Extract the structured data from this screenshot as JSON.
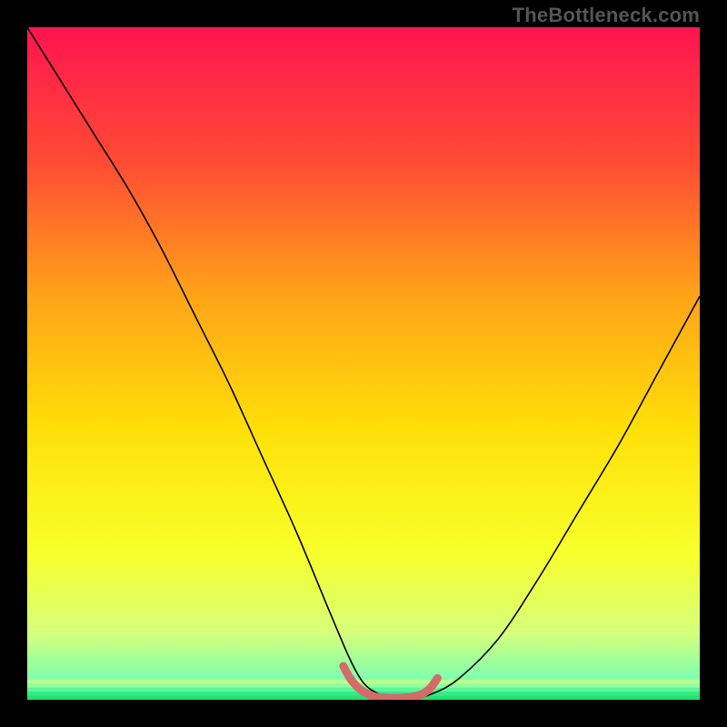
{
  "watermark": "TheBottleneck.com",
  "chart_data": {
    "type": "line",
    "title": "",
    "xlabel": "",
    "ylabel": "",
    "xlim": [
      0,
      100
    ],
    "ylim": [
      0,
      100
    ],
    "gradient_stops": [
      {
        "offset": 0.0,
        "color": "#ff1450"
      },
      {
        "offset": 0.2,
        "color": "#ff4b34"
      },
      {
        "offset": 0.4,
        "color": "#ffa418"
      },
      {
        "offset": 0.6,
        "color": "#ffe008"
      },
      {
        "offset": 0.78,
        "color": "#f8ff2a"
      },
      {
        "offset": 0.9,
        "color": "#d6ff7a"
      },
      {
        "offset": 0.97,
        "color": "#7dffb0"
      },
      {
        "offset": 1.0,
        "color": "#21e36e"
      }
    ],
    "green_band": {
      "y_start": 97.0,
      "y_end": 100.0
    },
    "series": [
      {
        "name": "bottleneck-curve",
        "stroke": "#000000",
        "stroke_width": 1.6,
        "x": [
          0,
          5,
          10,
          15,
          20,
          25,
          30,
          35,
          40,
          45,
          48,
          50,
          52,
          54,
          56,
          58,
          60,
          64,
          70,
          76,
          82,
          88,
          94,
          100
        ],
        "y": [
          100,
          92,
          84,
          76,
          67,
          57,
          47,
          36,
          25,
          13,
          6,
          2.5,
          1,
          0.4,
          0.2,
          0.3,
          0.8,
          3,
          9,
          18,
          28,
          38,
          49,
          60
        ]
      },
      {
        "name": "optimal-marker",
        "stroke": "#d46a6a",
        "stroke_width": 9,
        "linecap": "round",
        "x": [
          47,
          48,
          49,
          50,
          51,
          52,
          53,
          54,
          55,
          56,
          57,
          58,
          59,
          60,
          61
        ],
        "y": [
          5.0,
          3.2,
          2.0,
          1.2,
          0.7,
          0.4,
          0.3,
          0.25,
          0.25,
          0.3,
          0.4,
          0.6,
          1.0,
          1.8,
          3.2
        ]
      }
    ]
  }
}
